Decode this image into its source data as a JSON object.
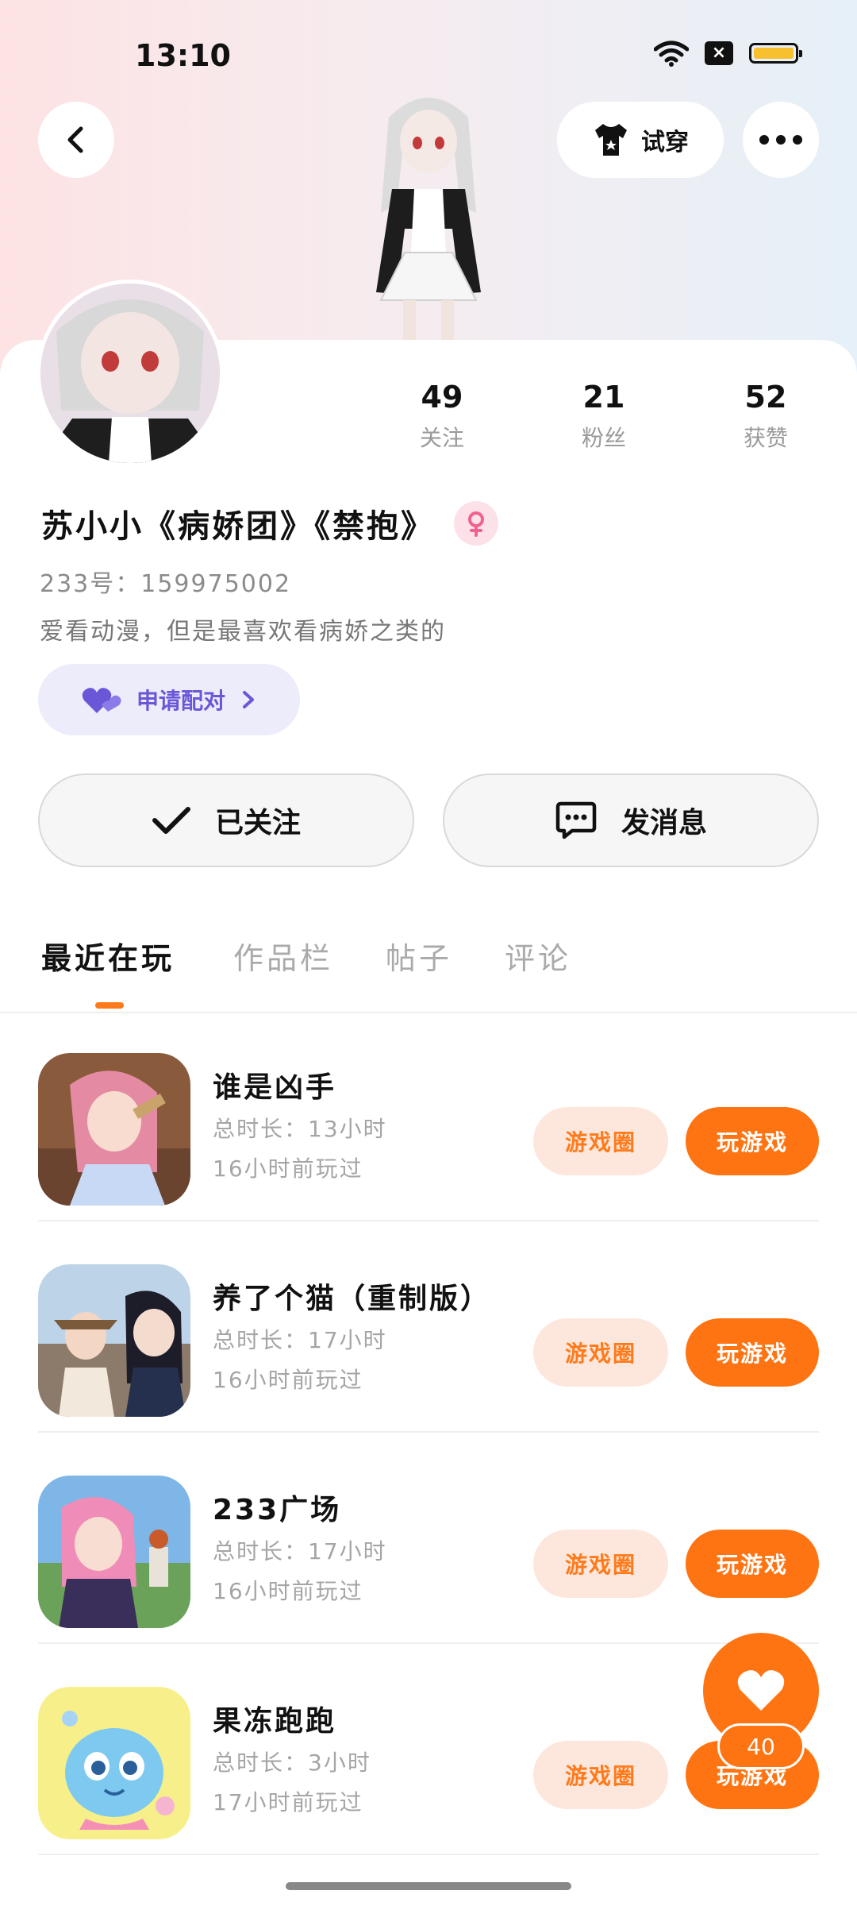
{
  "status_bar": {
    "time": "13:10"
  },
  "header": {
    "try_on_label": "试穿"
  },
  "profile": {
    "name": "苏小小《病娇团》《禁抱》",
    "id_text": "233号：159975002",
    "bio": "爱看动漫，但是最喜欢看病娇之类的",
    "pair_label": "申请配对",
    "stats": [
      {
        "value": "49",
        "label": "关注"
      },
      {
        "value": "21",
        "label": "粉丝"
      },
      {
        "value": "52",
        "label": "获赞"
      }
    ],
    "follow_label": "已关注",
    "message_label": "发消息"
  },
  "tabs": [
    {
      "label": "最近在玩"
    },
    {
      "label": "作品栏"
    },
    {
      "label": "帖子"
    },
    {
      "label": "评论"
    }
  ],
  "games": [
    {
      "title": "谁是凶手",
      "duration": "总时长：13小时",
      "last_played": "16小时前玩过",
      "circle_label": "游戏圈",
      "play_label": "玩游戏"
    },
    {
      "title": "养了个猫（重制版）",
      "duration": "总时长：17小时",
      "last_played": "16小时前玩过",
      "circle_label": "游戏圈",
      "play_label": "玩游戏"
    },
    {
      "title": "233广场",
      "duration": "总时长：17小时",
      "last_played": "16小时前玩过",
      "circle_label": "游戏圈",
      "play_label": "玩游戏"
    },
    {
      "title": "果冻跑跑",
      "duration": "总时长：3小时",
      "last_played": "17小时前玩过",
      "circle_label": "游戏圈",
      "play_label": "玩游戏"
    }
  ],
  "floating_like": {
    "count": "40"
  },
  "colors": {
    "accent": "#ff7412",
    "pair_purple": "#6a57d8",
    "gender_pink": "#f06292"
  }
}
